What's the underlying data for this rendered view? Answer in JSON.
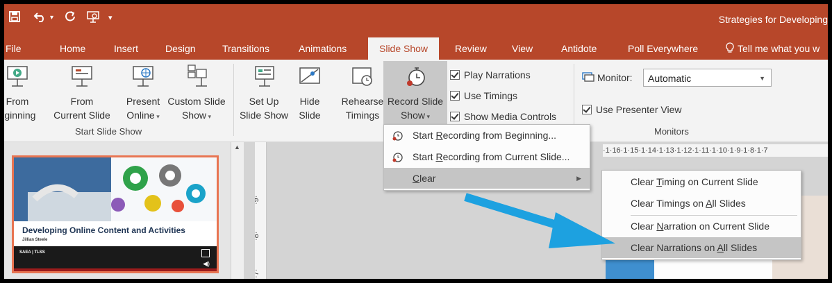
{
  "window": {
    "title": "Strategies for Developing"
  },
  "tabs": [
    {
      "label": "File"
    },
    {
      "label": "Home"
    },
    {
      "label": "Insert"
    },
    {
      "label": "Design"
    },
    {
      "label": "Transitions"
    },
    {
      "label": "Animations"
    },
    {
      "label": "Slide Show"
    },
    {
      "label": "Review"
    },
    {
      "label": "View"
    },
    {
      "label": "Antidote"
    },
    {
      "label": "Poll Everywhere"
    }
  ],
  "tell_me": "Tell me what you w",
  "ribbon": {
    "from_beginning": [
      "From",
      "eginning"
    ],
    "from_current": [
      "From",
      "Current Slide"
    ],
    "present_online": [
      "Present",
      "Online"
    ],
    "custom_slide_show": [
      "Custom Slide",
      "Show"
    ],
    "set_up": [
      "Set Up",
      "Slide Show"
    ],
    "hide_slide": [
      "Hide",
      "Slide"
    ],
    "rehearse": [
      "Rehearse",
      "Timings"
    ],
    "record": [
      "Record Slide",
      "Show"
    ],
    "play_narrations": "Play Narrations",
    "use_timings": "Use Timings",
    "show_media_controls": "Show Media Controls",
    "monitor_label": "Monitor:",
    "monitor_value": "Automatic",
    "use_presenter_view": "Use Presenter View",
    "group_start": "Start Slide Show",
    "group_monitors": "Monitors"
  },
  "record_menu": {
    "items": [
      {
        "pre": "Start ",
        "key": "R",
        "post": "ecording from Beginning..."
      },
      {
        "pre": "Start ",
        "key": "R",
        "post": "ecording from Current Slide..."
      },
      {
        "pre": "",
        "key": "C",
        "post": "lear"
      }
    ]
  },
  "clear_menu": {
    "items": [
      {
        "pre": "Clear ",
        "key": "T",
        "post": "iming on Current Slide"
      },
      {
        "pre": "Clear Timings on ",
        "key": "A",
        "post": "ll Slides"
      },
      {
        "pre": "Clear ",
        "key": "N",
        "post": "arration on Current Slide"
      },
      {
        "pre": "Clear Narrations on ",
        "key": "A",
        "post": "ll Slides"
      }
    ]
  },
  "ruler_text": "·1·16·1·15·1·14·1·13·1·12·1·11·1·10·1·9·1·8·1·7",
  "slide": {
    "title": "Developing Online Content and Activities",
    "author": "Jillian Steele",
    "footer": "SAEA | TLSS"
  },
  "colors": {
    "accent": "#b7472a",
    "arrow": "#1da1e0",
    "thumb_border": "#e87552"
  }
}
